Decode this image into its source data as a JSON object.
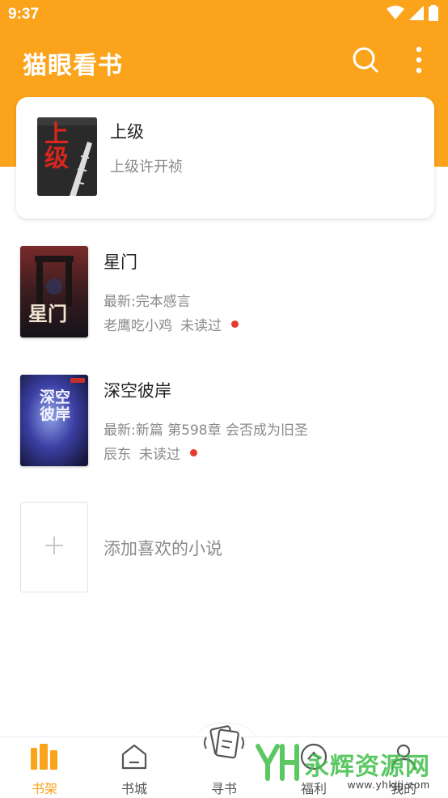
{
  "status_bar": {
    "time": "9:37"
  },
  "header": {
    "title": "猫眼看书",
    "search_icon": "search-icon",
    "more_icon": "more-vertical-icon"
  },
  "featured": {
    "title": "上级",
    "author": "上级许开祯",
    "cover_text": "上级"
  },
  "books": [
    {
      "title": "星门",
      "latest": "最新:完本感言",
      "author": "老鹰吃小鸡",
      "status": "未读过",
      "cover_text": "星门"
    },
    {
      "title": "深空彼岸",
      "latest": "最新:新篇 第598章 会否成为旧圣",
      "author": "辰东",
      "status": "未读过",
      "cover_text": "深空彼岸"
    }
  ],
  "add_book": {
    "label": "添加喜欢的小说"
  },
  "bottom_nav": [
    {
      "label": "书架",
      "icon": "bookshelf-icon",
      "active": true
    },
    {
      "label": "书城",
      "icon": "bookstore-icon",
      "active": false
    },
    {
      "label": "寻书",
      "icon": "find-book-icon",
      "active": false
    },
    {
      "label": "福利",
      "icon": "welfare-icon",
      "active": false
    },
    {
      "label": "我的",
      "icon": "profile-icon",
      "active": false
    }
  ],
  "watermark": {
    "text": "永辉资源网",
    "url": "www.yhkjjj.com"
  },
  "colors": {
    "accent": "#FBA31B",
    "unread_dot": "#E63B2E",
    "watermark": "#3FBF4A"
  }
}
